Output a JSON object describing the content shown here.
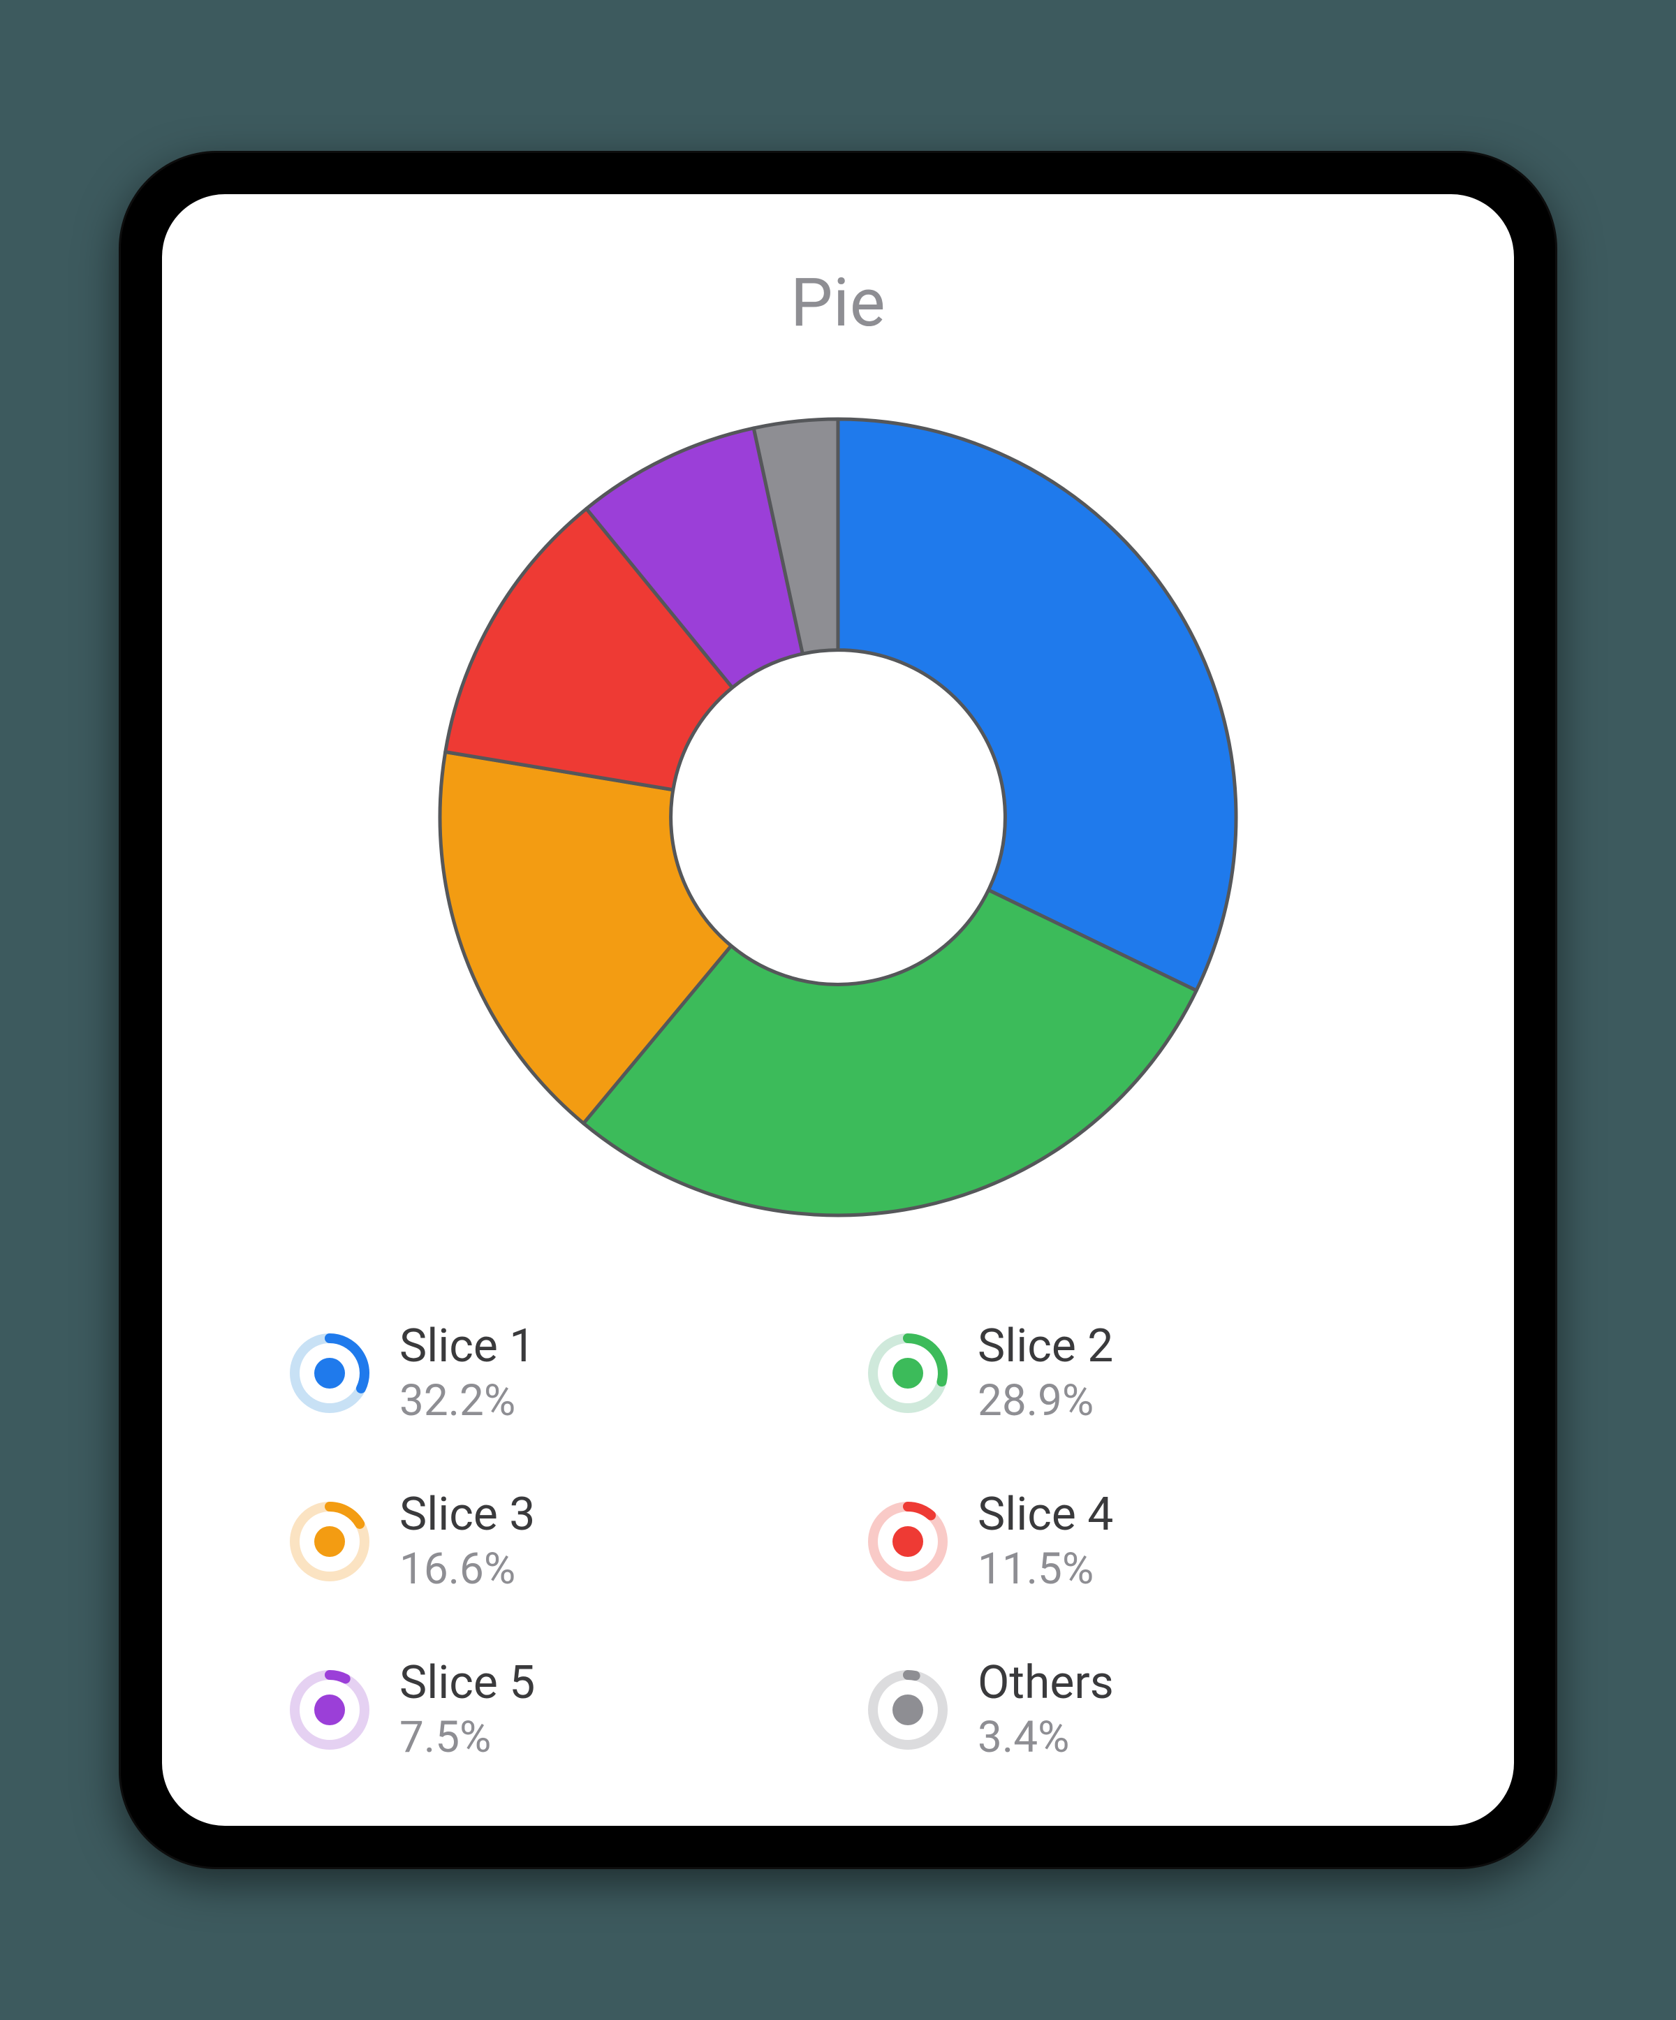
{
  "title": "Pie",
  "chart_data": {
    "type": "pie",
    "title": "Pie",
    "series": [
      {
        "name": "Slice 1",
        "value": 32.2,
        "color": "#1f7aec"
      },
      {
        "name": "Slice 2",
        "value": 28.9,
        "color": "#3cbb5a"
      },
      {
        "name": "Slice 3",
        "value": 16.6,
        "color": "#f39c12"
      },
      {
        "name": "Slice 4",
        "value": 11.5,
        "color": "#ee3a34"
      },
      {
        "name": "Slice 5",
        "value": 7.5,
        "color": "#9b3fd8"
      },
      {
        "name": "Others",
        "value": 3.4,
        "color": "#8e8e93"
      }
    ],
    "donut_inner_ratio": 0.42,
    "stroke": "#55575a",
    "stroke_width": 5
  },
  "legend": [
    {
      "label": "Slice 1",
      "percent_text": "32.2%",
      "percent": 32.2,
      "color": "#1f7aec",
      "ring_bg": "#c8e1f5"
    },
    {
      "label": "Slice 2",
      "percent_text": "28.9%",
      "percent": 28.9,
      "color": "#3cbb5a",
      "ring_bg": "#cfe9db"
    },
    {
      "label": "Slice 3",
      "percent_text": "16.6%",
      "percent": 16.6,
      "color": "#f39c12",
      "ring_bg": "#fbe3c2"
    },
    {
      "label": "Slice 4",
      "percent_text": "11.5%",
      "percent": 11.5,
      "color": "#ee3a34",
      "ring_bg": "#f9cac7"
    },
    {
      "label": "Slice 5",
      "percent_text": "7.5%",
      "percent": 7.5,
      "color": "#9b3fd8",
      "ring_bg": "#e5d1f2"
    },
    {
      "label": "Others",
      "percent_text": "3.4%",
      "percent": 3.4,
      "color": "#8e8e93",
      "ring_bg": "#dcdcde"
    }
  ]
}
